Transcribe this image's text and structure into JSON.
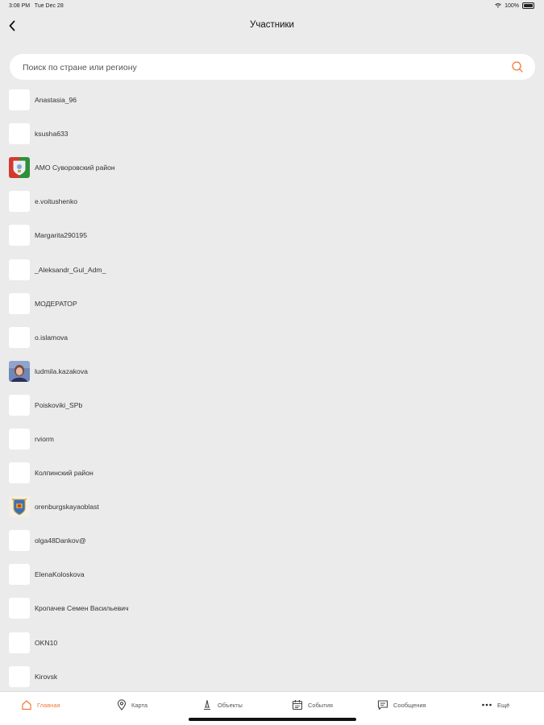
{
  "status_bar": {
    "time": "3:08 PM",
    "date": "Tue Dec 28",
    "battery": "100%"
  },
  "nav": {
    "title": "Участники"
  },
  "search": {
    "placeholder": "Поиск по стране или региону"
  },
  "participants": [
    {
      "name": "Anastasia_96",
      "avatar": "blank"
    },
    {
      "name": "ksusha633",
      "avatar": "blank"
    },
    {
      "name": "АМО Суворовский район",
      "avatar": "emblem"
    },
    {
      "name": "e.voitushenko",
      "avatar": "blank"
    },
    {
      "name": "Margarita290195",
      "avatar": "blank"
    },
    {
      "name": "_Aleksandr_Gul_Adm_",
      "avatar": "blank"
    },
    {
      "name": "МОДЕРАТОР",
      "avatar": "blank"
    },
    {
      "name": "o.islamova",
      "avatar": "blank"
    },
    {
      "name": "ludmila.kazakova",
      "avatar": "photo"
    },
    {
      "name": "Poiskoviki_SPb",
      "avatar": "blank"
    },
    {
      "name": "rviorm",
      "avatar": "blank"
    },
    {
      "name": "Колпинский район",
      "avatar": "blank"
    },
    {
      "name": "orenburgskayaoblast",
      "avatar": "coat-of-arms"
    },
    {
      "name": "olga48Dankov@",
      "avatar": "blank"
    },
    {
      "name": "ElenaKoloskova",
      "avatar": "blank"
    },
    {
      "name": "Кропачев Семен Васильевич",
      "avatar": "blank"
    },
    {
      "name": "OKN10",
      "avatar": "blank"
    },
    {
      "name": "Kirovsk",
      "avatar": "blank"
    }
  ],
  "tabs": [
    {
      "label": "Главная",
      "icon": "home-icon",
      "active": true
    },
    {
      "label": "Карта",
      "icon": "map-pin-icon",
      "active": false
    },
    {
      "label": "Объекты",
      "icon": "monument-icon",
      "active": false
    },
    {
      "label": "События",
      "icon": "calendar-icon",
      "active": false
    },
    {
      "label": "Сообщения",
      "icon": "message-icon",
      "active": false
    },
    {
      "label": "Ещё",
      "icon": "more-icon",
      "active": false
    }
  ],
  "colors": {
    "accent": "#f07a3a",
    "background": "#ebebeb"
  }
}
